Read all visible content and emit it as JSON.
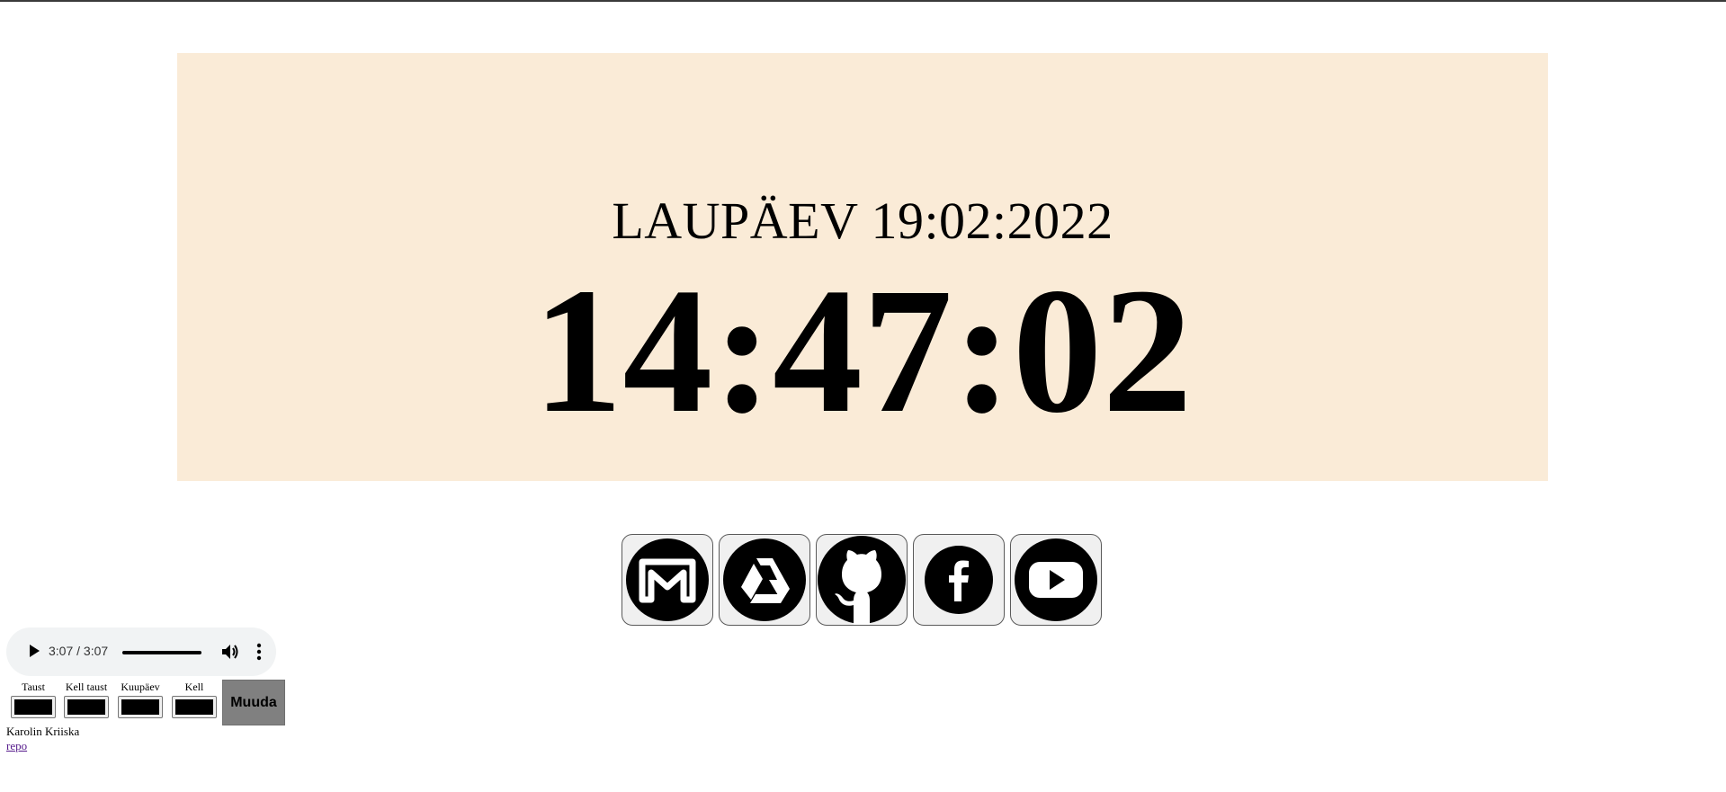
{
  "clock": {
    "date": "LAUPÄEV 19:02:2022",
    "time": "14:47:02",
    "panel_color": "#faebd7"
  },
  "links": [
    {
      "name": "gmail-icon"
    },
    {
      "name": "google-drive-icon"
    },
    {
      "name": "github-icon"
    },
    {
      "name": "facebook-icon"
    },
    {
      "name": "youtube-icon"
    }
  ],
  "audio": {
    "time": "3:07 / 3:07",
    "icons": [
      "play-icon",
      "volume-icon",
      "more-options-icon"
    ]
  },
  "color_controls": {
    "background_label": "Taust",
    "clock_background_label": "Kell taust",
    "date_label": "Kuupäev",
    "clock_label": "Kell",
    "background_value": "#000000",
    "clock_background_value": "#000000",
    "date_value": "#000000",
    "clock_value": "#000000",
    "button_label": "Muuda"
  },
  "footer": {
    "author": "Karolin Kriiska",
    "repo_link": "repo"
  }
}
